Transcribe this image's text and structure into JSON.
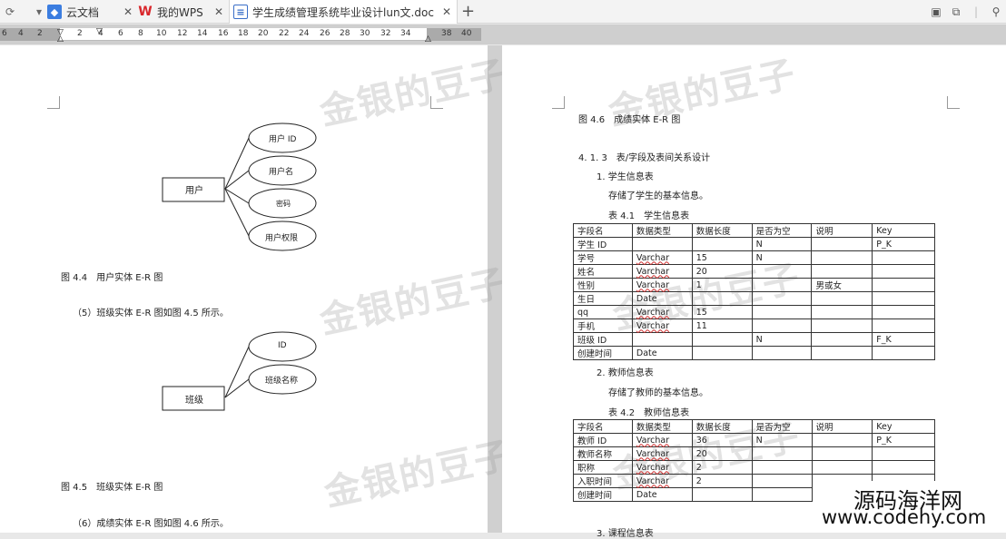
{
  "tabs": [
    {
      "label": "云文档"
    },
    {
      "label": "我的WPS"
    },
    {
      "label": "学生成绩管理系统毕业设计lun文.doc"
    }
  ],
  "ruler": {
    "numbers": [
      "6",
      "4",
      "2",
      "2",
      "4",
      "6",
      "8",
      "10",
      "12",
      "14",
      "16",
      "18",
      "20",
      "22",
      "24",
      "26",
      "28",
      "30",
      "32",
      "34",
      "38",
      "40"
    ]
  },
  "watermark": "金银的豆子",
  "left_page": {
    "er1": {
      "entity": "用户",
      "attrs": [
        "用户 ID",
        "用户名",
        "密码",
        "用户权限"
      ]
    },
    "caption1": "图 4.4　用户实体 E-R 图",
    "para1": "（5）班级实体 E-R 图如图 4.5 所示。",
    "er2": {
      "entity": "班级",
      "attrs": [
        "ID",
        "班级名称"
      ]
    },
    "caption2": "图 4.5　班级实体 E-R 图",
    "para2": "（6）成绩实体 E-R 图如图 4.6 所示。"
  },
  "right_page": {
    "caption": "图 4.6　成绩实体 E-R 图",
    "section": "4. 1. 3　表/字段及表间关系设计",
    "item1": "1. 学生信息表",
    "desc1": "存储了学生的基本信息。",
    "table1_title": "表 4.1　学生信息表",
    "table1": {
      "headers": [
        "字段名",
        "数据类型",
        "数据长度",
        "是否为空",
        "说明",
        "Key"
      ],
      "rows": [
        [
          "学生 ID",
          "",
          "",
          "N",
          "",
          "P_K"
        ],
        [
          "学号",
          "Varchar",
          "15",
          "N",
          "",
          ""
        ],
        [
          "姓名",
          "Varchar",
          "20",
          "",
          "",
          ""
        ],
        [
          "性别",
          "Varchar",
          "1",
          "",
          "男或女",
          ""
        ],
        [
          "生日",
          "Date",
          "",
          "",
          "",
          ""
        ],
        [
          "qq",
          "Varchar",
          "15",
          "",
          "",
          ""
        ],
        [
          "手机",
          "Varchar",
          "11",
          "",
          "",
          ""
        ],
        [
          "班级 ID",
          "",
          "",
          "N",
          "",
          "F_K"
        ],
        [
          "创建时间",
          "Date",
          "",
          "",
          "",
          ""
        ]
      ]
    },
    "item2": "2. 教师信息表",
    "desc2": "存储了教师的基本信息。",
    "table2_title": "表 4.2　教师信息表",
    "table2": {
      "headers": [
        "字段名",
        "数据类型",
        "数据长度",
        "是否为空",
        "说明",
        "Key"
      ],
      "rows": [
        [
          "教师 ID",
          "Varchar",
          "36",
          "N",
          "",
          "P_K"
        ],
        [
          "教师名称",
          "Varchar",
          "20",
          "",
          "",
          ""
        ],
        [
          "职称",
          "Varchar",
          "2",
          "",
          "",
          ""
        ],
        [
          "入职时间",
          "Varchar",
          "2",
          "",
          "",
          ""
        ],
        [
          "创建时间",
          "Date",
          "",
          "",
          "",
          ""
        ]
      ]
    },
    "item3": "3. 课程信息表"
  },
  "brand": {
    "cn": "源码海洋网",
    "url": "www.codehy.com"
  }
}
